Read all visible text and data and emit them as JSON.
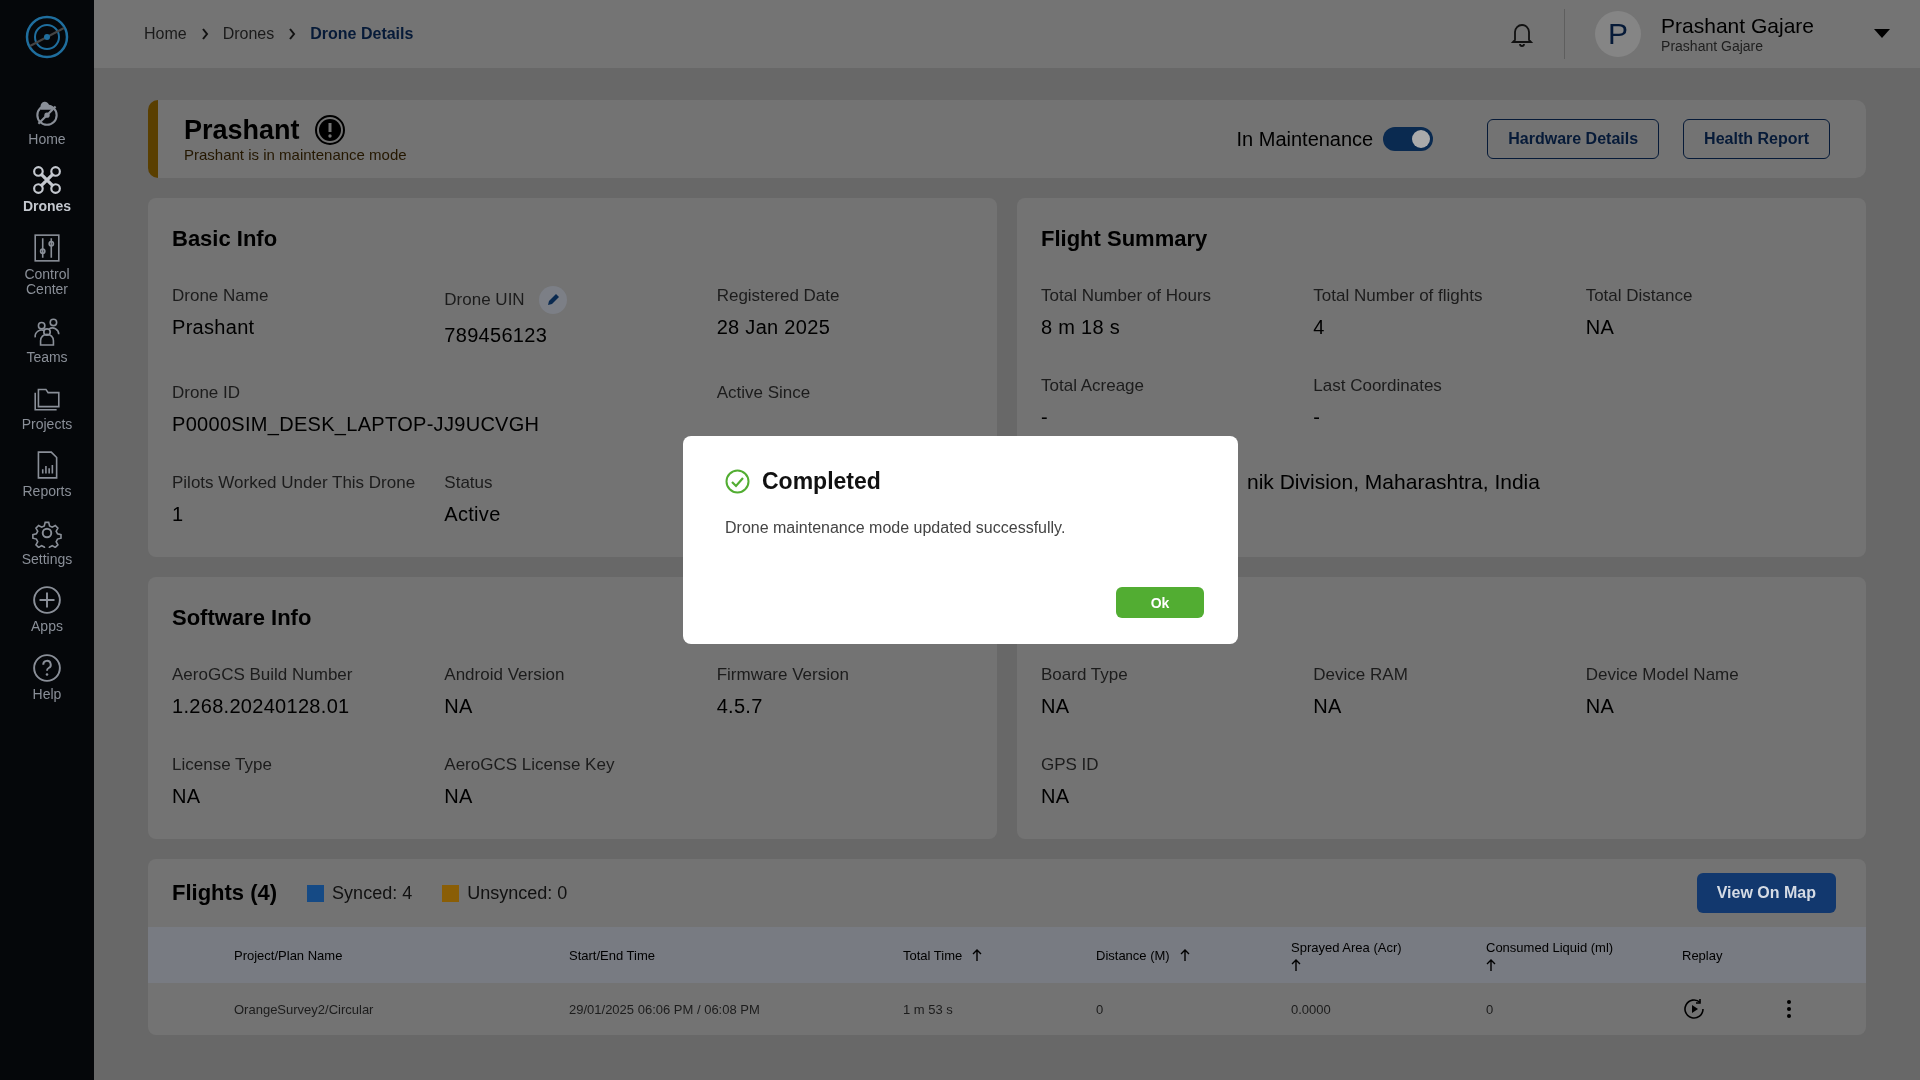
{
  "sidebar": {
    "items": [
      {
        "label": "Home",
        "selected": false
      },
      {
        "label": "Drones",
        "selected": true
      },
      {
        "label": "Control Center",
        "selected": false
      },
      {
        "label": "Teams",
        "selected": false
      },
      {
        "label": "Projects",
        "selected": false
      },
      {
        "label": "Reports",
        "selected": false
      },
      {
        "label": "Settings",
        "selected": false
      },
      {
        "label": "Apps",
        "selected": false
      },
      {
        "label": "Help",
        "selected": false
      }
    ]
  },
  "breadcrumb": [
    {
      "label": "Home",
      "selected": false
    },
    {
      "label": "Drones",
      "selected": false
    },
    {
      "label": "Drone Details",
      "selected": true
    }
  ],
  "user": {
    "initial": "P",
    "name": "Prashant Gajare",
    "subtitle": "Prashant Gajare"
  },
  "drone_header": {
    "name": "Prashant",
    "status_message": "Prashant is in maintenance mode",
    "maintenance_label": "In Maintenance",
    "maintenance_on": true,
    "buttons": [
      "Hardware Details",
      "Health Report"
    ]
  },
  "basic_info": {
    "title": "Basic Info",
    "fields": [
      {
        "label": "Drone Name",
        "value": "Prashant"
      },
      {
        "label": "Drone UIN",
        "value": "789456123",
        "editable": true
      },
      {
        "label": "Registered Date",
        "value": "28 Jan 2025"
      },
      {
        "label": "Drone ID",
        "value": "P0000SIM_DESK_LAPTOP-JJ9UCVGH"
      },
      {
        "label": "Active Since"
      },
      {
        "label": "Pilots Worked Under This Drone",
        "value": "1"
      },
      {
        "label": "Status",
        "value": "Active"
      }
    ]
  },
  "flight_summary": {
    "title": "Flight Summary",
    "fields": [
      {
        "label": "Total Number of Hours",
        "value": "8 m 18 s"
      },
      {
        "label": "Total Number of flights",
        "value": "4"
      },
      {
        "label": "Total Distance",
        "value": "NA"
      },
      {
        "label": "Total Acreage",
        "value": "-"
      },
      {
        "label": "Last Coordinates",
        "value": "-"
      }
    ],
    "location": "nik Division, Maharashtra, India"
  },
  "software_info": {
    "title": "Software Info",
    "fields": [
      {
        "label": "AeroGCS Build Number",
        "value": "1.268.20240128.01"
      },
      {
        "label": "Android Version",
        "value": "NA"
      },
      {
        "label": "Firmware Version",
        "value": "4.5.7"
      },
      {
        "label": "License Type",
        "value": "NA"
      },
      {
        "label": "AeroGCS License Key",
        "value": "NA"
      }
    ]
  },
  "hardware_info": {
    "fields": [
      {
        "label": "Board Type",
        "value": "NA"
      },
      {
        "label": "Device RAM",
        "value": "NA"
      },
      {
        "label": "Device Model Name",
        "value": "NA"
      },
      {
        "label": "GPS ID",
        "value": "NA"
      }
    ]
  },
  "flights": {
    "title": "Flights (4)",
    "legend": [
      {
        "label": "Synced: 4",
        "color": "#154a85"
      },
      {
        "label": "Unsynced: 0",
        "color": "#8a5e06"
      }
    ],
    "map_button": "View On Map",
    "columns": [
      {
        "label": "Project/Plan Name",
        "sortable": false
      },
      {
        "label": "Start/End Time",
        "sortable": false
      },
      {
        "label": "Total Time",
        "sortable": true
      },
      {
        "label": "Distance (M)",
        "sortable": true
      },
      {
        "label": "Sprayed Area (Acr)",
        "sortable": true
      },
      {
        "label": "Consumed Liquid (ml)",
        "sortable": true
      },
      {
        "label": "Replay",
        "sortable": false
      }
    ],
    "rows": [
      {
        "cells": [
          "OrangeSurvey2/Circular",
          "29/01/2025 06:06 PM / 06:08 PM",
          "1 m 53 s",
          "0",
          "0.0000",
          "0"
        ]
      }
    ]
  },
  "dialog": {
    "title": "Completed",
    "message": "Drone maintenance mode updated successfully.",
    "button": "Ok"
  }
}
